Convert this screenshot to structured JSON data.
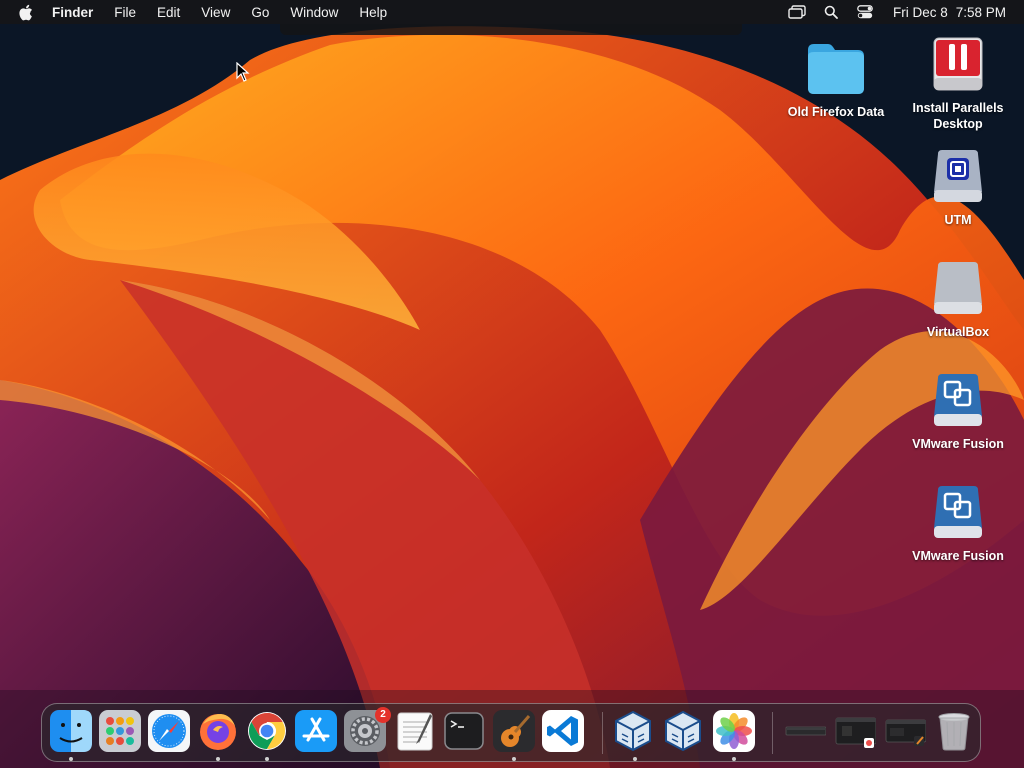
{
  "menubar": {
    "app_name": "Finder",
    "menus": [
      "File",
      "Edit",
      "View",
      "Go",
      "Window",
      "Help"
    ],
    "status_icons": [
      "screen-mirroring-icon",
      "spotlight-search-icon",
      "control-center-icon"
    ],
    "clock": {
      "date": "Fri Dec 8",
      "time": "7:58 PM"
    }
  },
  "desktop_icons": [
    {
      "label": "Old Firefox Data",
      "icon": "folder-icon"
    },
    {
      "label": "Install Parallels Desktop",
      "icon": "parallels-disk-icon"
    },
    {
      "label": "UTM",
      "icon": "utm-disk-icon"
    },
    {
      "label": "VirtualBox",
      "icon": "virtualbox-disk-icon"
    },
    {
      "label": "VMware Fusion",
      "icon": "vmware-disk-icon"
    },
    {
      "label": "VMware Fusion",
      "icon": "vmware-disk-icon"
    }
  ],
  "dock": {
    "apps": [
      "finder",
      "launchpad",
      "safari",
      "firefox",
      "chrome",
      "app-store",
      "system-settings",
      "textedit",
      "terminal",
      "garageband",
      "vscode",
      "virtualbox",
      "virtualbox",
      "photos"
    ],
    "system_settings_badge": "2",
    "recent_items": [
      "minimized-window",
      "minimized-window",
      "minimized-window"
    ],
    "trash": "trash"
  },
  "colors": {
    "menubar_bg": "#161618",
    "folder_blue": "#5cc2f0",
    "badge_red": "#e4322b",
    "parallels_red": "#d9232f"
  }
}
